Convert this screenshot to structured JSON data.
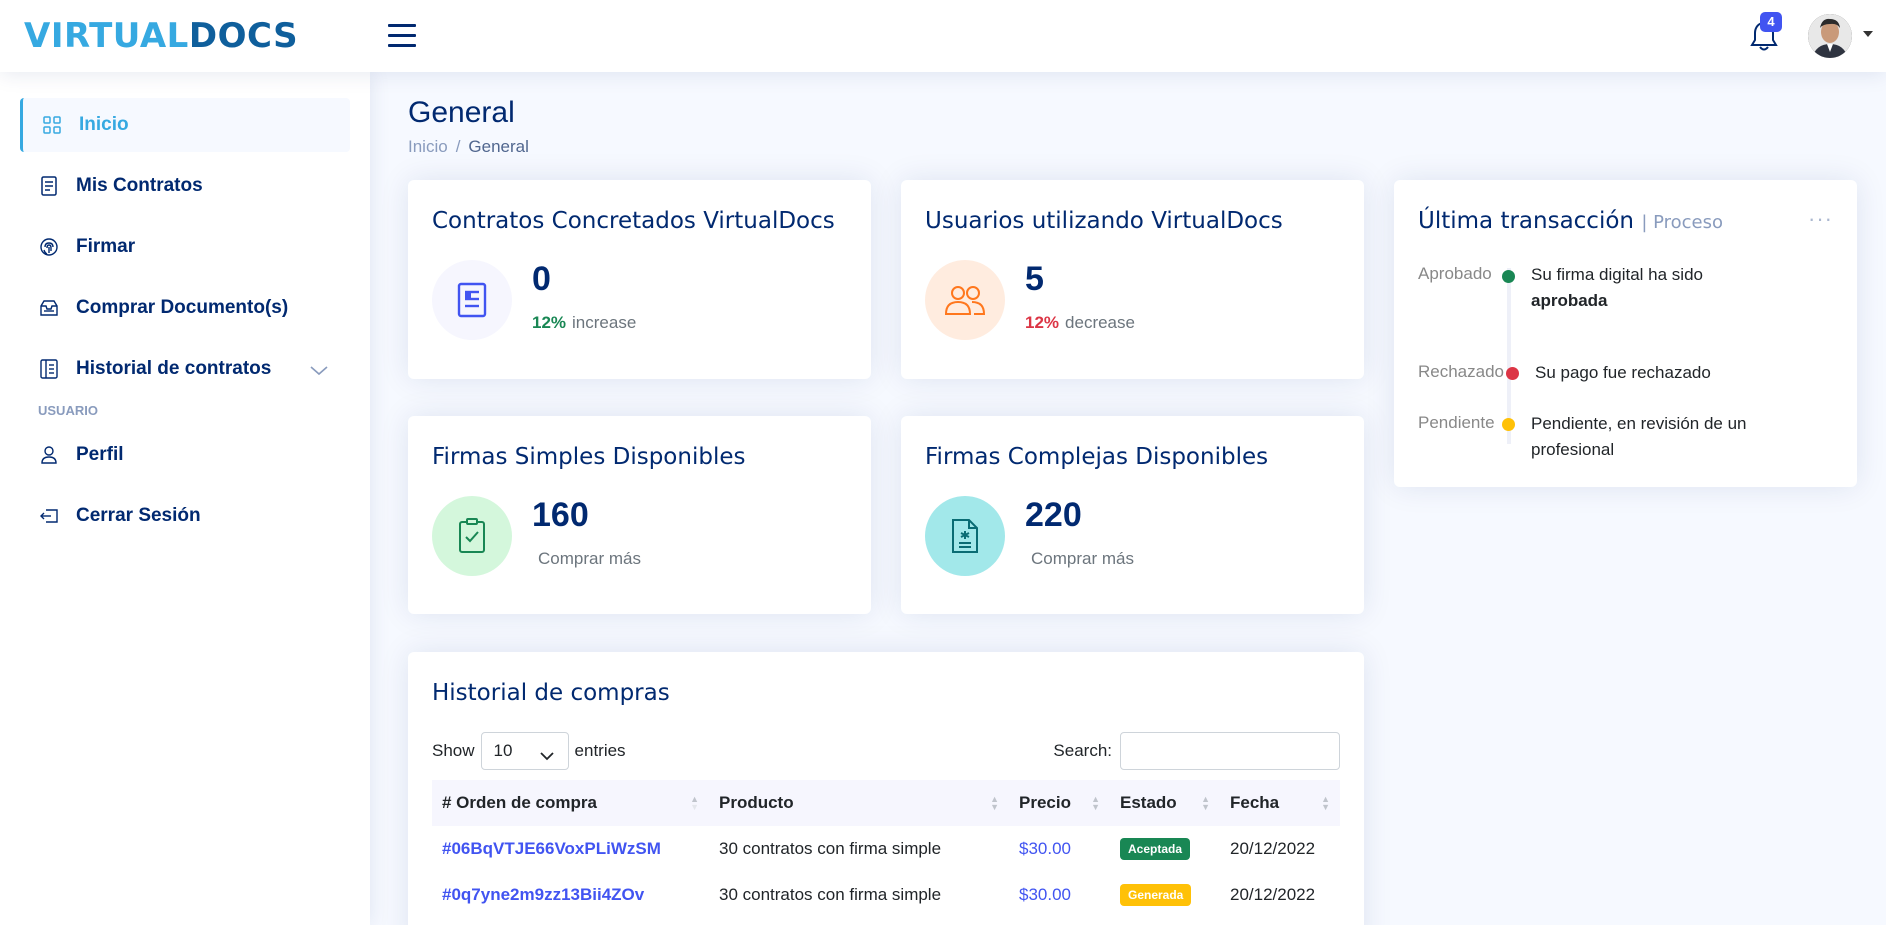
{
  "header": {
    "logo_part1": "VIRTUAL",
    "logo_part2": "DOCS",
    "notification_count": "4",
    "brand_colors": {
      "light": "#36a9e1",
      "dark": "#0f5f9c"
    }
  },
  "sidebar": {
    "items": [
      {
        "label": "Inicio",
        "icon": "grid-icon",
        "active": true
      },
      {
        "label": "Mis Contratos",
        "icon": "document-icon"
      },
      {
        "label": "Firmar",
        "icon": "fingerprint-icon"
      },
      {
        "label": "Comprar Documento(s)",
        "icon": "inbox-icon"
      },
      {
        "label": "Historial de contratos",
        "icon": "layout-text-icon",
        "has_submenu": true
      }
    ],
    "section_heading": "USUARIO",
    "user_items": [
      {
        "label": "Perfil",
        "icon": "person-icon"
      },
      {
        "label": "Cerrar Sesión",
        "icon": "box-arrow-left-icon"
      }
    ]
  },
  "page": {
    "title": "General",
    "breadcrumb": {
      "home": "Inicio",
      "separator": "/",
      "current": "General"
    }
  },
  "cards": {
    "contratos": {
      "title": "Contratos Concretados VirtualDocs",
      "value": "0",
      "pct": "12%",
      "trend": "increase"
    },
    "usuarios": {
      "title": "Usuarios utilizando VirtualDocs",
      "value": "5",
      "pct": "12%",
      "trend": "decrease"
    },
    "simples": {
      "title": "Firmas Simples Disponibles",
      "value": "160",
      "action": "Comprar más"
    },
    "complejas": {
      "title": "Firmas Complejas Disponibles",
      "value": "220",
      "action": "Comprar más"
    }
  },
  "transaction": {
    "title": "Última transacción",
    "subtitle": "| Proceso",
    "menu": "···",
    "items": [
      {
        "label": "Aprobado",
        "text_pre": "Su firma digital ha sido",
        "text_bold": "aprobada",
        "color": "#198754"
      },
      {
        "label": "Rechazado",
        "text": "Su pago fue rechazado",
        "color": "#dc3545"
      },
      {
        "label": "Pendiente",
        "text": "Pendiente, en revisión de un profesional",
        "color": "#ffc107"
      }
    ]
  },
  "history": {
    "title": "Historial de compras",
    "show_label": "Show",
    "entries_value": "10",
    "entries_label": "entries",
    "search_label": "Search:",
    "columns": [
      "# Orden de compra",
      "Producto",
      "Precio",
      "Estado",
      "Fecha"
    ],
    "rows": [
      {
        "order": "#06BqVTJE66VoxPLiWzSM",
        "product": "30 contratos con firma simple",
        "price": "$30.00",
        "status": "Aceptada",
        "date": "20/12/2022"
      },
      {
        "order": "#0q7yne2m9zz13Bii4ZOv",
        "product": "30 contratos con firma simple",
        "price": "$30.00",
        "status": "Generada",
        "date": "20/12/2022"
      }
    ]
  }
}
